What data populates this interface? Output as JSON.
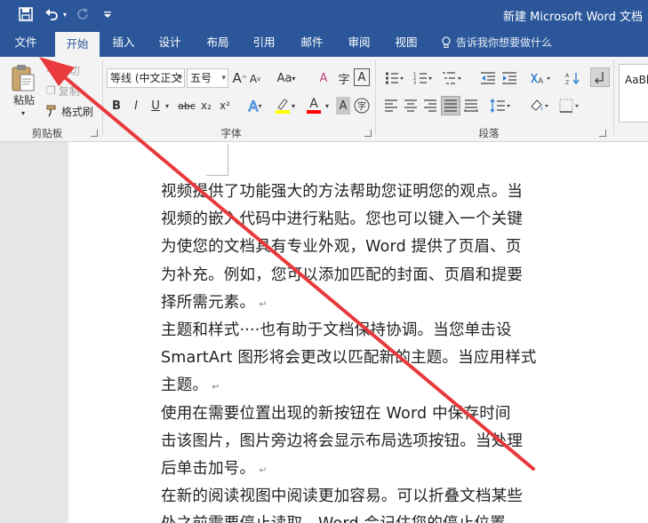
{
  "window": {
    "title": "新建 Microsoft Word 文档",
    "quick_access": [
      "save-icon",
      "undo-icon",
      "undo-dropdown-icon",
      "redo-icon",
      "customize-qat-icon"
    ]
  },
  "tabs": [
    {
      "label": "文件"
    },
    {
      "label": "开始",
      "active": true
    },
    {
      "label": "插入"
    },
    {
      "label": "设计"
    },
    {
      "label": "布局"
    },
    {
      "label": "引用"
    },
    {
      "label": "邮件"
    },
    {
      "label": "审阅"
    },
    {
      "label": "视图"
    }
  ],
  "tell_me": "告诉我你想要做什么",
  "ribbon": {
    "clipboard": {
      "paste_label": "粘贴",
      "cut_label": "剪切",
      "copy_label": "复制",
      "format_painter_label": "格式刷",
      "group_label": "剪贴板"
    },
    "font": {
      "font_name": "等线 (中文正文",
      "font_size": "五号",
      "group_label": "字体",
      "bold": "B",
      "italic": "I",
      "underline": "U",
      "strikethrough": "abc",
      "subscript": "x₂",
      "superscript": "x²",
      "grow": "A",
      "shrink": "A",
      "change_case": "Aa",
      "text_effects": "A",
      "clear_format": "A",
      "char_border": "A",
      "font_color": "A",
      "char_shading": "A",
      "enclose": "字"
    },
    "paragraph": {
      "group_label": "段落"
    },
    "styles": {
      "preview": "AaBl"
    },
    "accent_colors": {
      "title_bar": "#2b579a",
      "highlight": "#ffff00",
      "font_color": "#ff0000",
      "annotation_arrow": "#e8393c"
    }
  },
  "document": {
    "lines": [
      {
        "text": "视频提供了功能强大的方法帮助您证明您的观点。当",
        "mark": false
      },
      {
        "text": "视频的嵌入代码中进行粘贴。您也可以键入一个关键",
        "mark": false
      },
      {
        "text": "为使您的文档具有专业外观，Word 提供了页眉、页",
        "mark": false
      },
      {
        "text": "为补充。例如，您可以添加匹配的封面、页眉和提要",
        "mark": false
      },
      {
        "text": "择所需元素。",
        "mark": true
      },
      {
        "text": "主题和样式····也有助于文档保持协调。当您单击设",
        "mark": false
      },
      {
        "text": "SmartArt 图形将会更改以匹配新的主题。当应用样式",
        "mark": false
      },
      {
        "text": "主题。",
        "mark": true
      },
      {
        "text": "使用在需要位置出现的新按钮在 Word 中保存时间",
        "mark": false
      },
      {
        "text": "击该图片，图片旁边将会显示布局选项按钮。当处理",
        "mark": false
      },
      {
        "text": "后单击加号。",
        "mark": true
      },
      {
        "text": "在新的阅读视图中阅读更加容易。可以折叠文档某些",
        "mark": false
      },
      {
        "text": "处之前需要停止读取，Word 会记住您的停止位置",
        "mark": false
      }
    ],
    "paragraph_mark": "↵"
  }
}
